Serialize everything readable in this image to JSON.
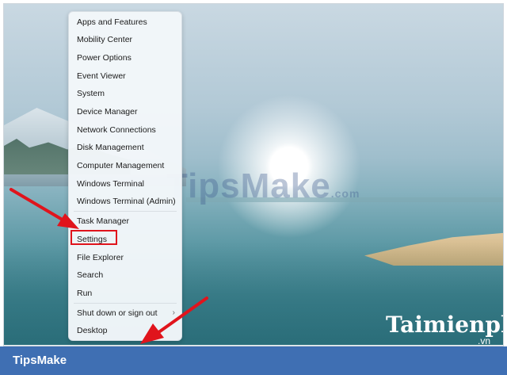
{
  "menu": {
    "items": [
      "Apps and Features",
      "Mobility Center",
      "Power Options",
      "Event Viewer",
      "System",
      "Device Manager",
      "Network Connections",
      "Disk Management",
      "Computer Management",
      "Windows Terminal",
      "Windows Terminal (Admin)",
      "Task Manager",
      "Settings",
      "File Explorer",
      "Search",
      "Run",
      "Shut down or sign out",
      "Desktop"
    ],
    "highlighted_item": "Settings",
    "submenu_indicator": "›"
  },
  "watermarks": {
    "tipsmake": "TipsMake",
    "tipsmake_suffix": ".com",
    "taimienphi": "Taimienphi",
    "taimienphi_suffix": ".vn"
  },
  "footer": {
    "brand": "TipsMake"
  },
  "colors": {
    "highlight": "#e0141c",
    "arrow": "#e0141c",
    "footer_bg": "#3f6fb3"
  }
}
